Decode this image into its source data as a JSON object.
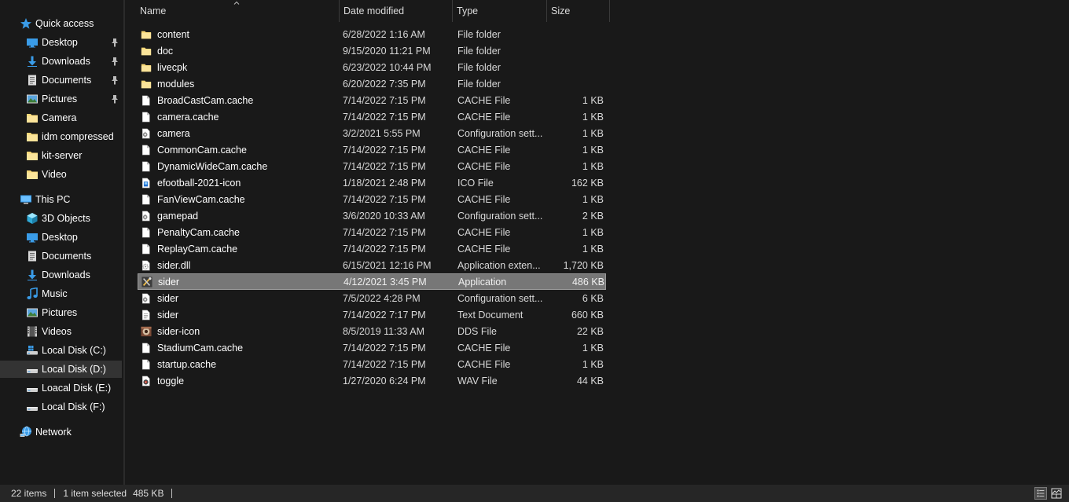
{
  "nav": {
    "quick_access": "Quick access",
    "quick_items": [
      {
        "label": "Desktop",
        "icon": "desktop-icon",
        "pinned": true
      },
      {
        "label": "Downloads",
        "icon": "download-icon",
        "pinned": true
      },
      {
        "label": "Documents",
        "icon": "documents-icon",
        "pinned": true
      },
      {
        "label": "Pictures",
        "icon": "pictures-icon",
        "pinned": true
      },
      {
        "label": "Camera",
        "icon": "folder-icon",
        "pinned": false
      },
      {
        "label": "idm compressed",
        "icon": "folder-icon",
        "pinned": false
      },
      {
        "label": "kit-server",
        "icon": "folder-icon",
        "pinned": false
      },
      {
        "label": "Video",
        "icon": "folder-icon",
        "pinned": false
      }
    ],
    "this_pc": "This PC",
    "pc_items": [
      {
        "label": "3D Objects",
        "icon": "3d-objects-icon"
      },
      {
        "label": "Desktop",
        "icon": "desktop-icon"
      },
      {
        "label": "Documents",
        "icon": "documents-icon"
      },
      {
        "label": "Downloads",
        "icon": "download-icon"
      },
      {
        "label": "Music",
        "icon": "music-icon"
      },
      {
        "label": "Pictures",
        "icon": "pictures-icon"
      },
      {
        "label": "Videos",
        "icon": "videos-icon"
      },
      {
        "label": "Local Disk (C:)",
        "icon": "windows-drive-icon"
      },
      {
        "label": "Local Disk (D:)",
        "icon": "drive-icon",
        "selected": true
      },
      {
        "label": "Loacal Disk (E:)",
        "icon": "drive-icon"
      },
      {
        "label": "Local Disk (F:)",
        "icon": "drive-icon"
      }
    ],
    "network": "Network"
  },
  "columns": {
    "name": "Name",
    "date": "Date modified",
    "type": "Type",
    "size": "Size"
  },
  "files": [
    {
      "name": "content",
      "date": "6/28/2022 1:16 AM",
      "type": "File folder",
      "size": "",
      "icon": "folder-icon"
    },
    {
      "name": "doc",
      "date": "9/15/2020 11:21 PM",
      "type": "File folder",
      "size": "",
      "icon": "folder-icon"
    },
    {
      "name": "livecpk",
      "date": "6/23/2022 10:44 PM",
      "type": "File folder",
      "size": "",
      "icon": "folder-icon"
    },
    {
      "name": "modules",
      "date": "6/20/2022 7:35 PM",
      "type": "File folder",
      "size": "",
      "icon": "folder-icon"
    },
    {
      "name": "BroadCastCam.cache",
      "date": "7/14/2022 7:15 PM",
      "type": "CACHE File",
      "size": "1 KB",
      "icon": "file-icon"
    },
    {
      "name": "camera.cache",
      "date": "7/14/2022 7:15 PM",
      "type": "CACHE File",
      "size": "1 KB",
      "icon": "file-icon"
    },
    {
      "name": "camera",
      "date": "3/2/2021 5:55 PM",
      "type": "Configuration sett...",
      "size": "1 KB",
      "icon": "config-file-icon"
    },
    {
      "name": "CommonCam.cache",
      "date": "7/14/2022 7:15 PM",
      "type": "CACHE File",
      "size": "1 KB",
      "icon": "file-icon"
    },
    {
      "name": "DynamicWideCam.cache",
      "date": "7/14/2022 7:15 PM",
      "type": "CACHE File",
      "size": "1 KB",
      "icon": "file-icon"
    },
    {
      "name": "efootball-2021-icon",
      "date": "1/18/2021 2:48 PM",
      "type": "ICO File",
      "size": "162 KB",
      "icon": "ico-file-icon"
    },
    {
      "name": "FanViewCam.cache",
      "date": "7/14/2022 7:15 PM",
      "type": "CACHE File",
      "size": "1 KB",
      "icon": "file-icon"
    },
    {
      "name": "gamepad",
      "date": "3/6/2020 10:33 AM",
      "type": "Configuration sett...",
      "size": "2 KB",
      "icon": "config-file-icon"
    },
    {
      "name": "PenaltyCam.cache",
      "date": "7/14/2022 7:15 PM",
      "type": "CACHE File",
      "size": "1 KB",
      "icon": "file-icon"
    },
    {
      "name": "ReplayCam.cache",
      "date": "7/14/2022 7:15 PM",
      "type": "CACHE File",
      "size": "1 KB",
      "icon": "file-icon"
    },
    {
      "name": "sider.dll",
      "date": "6/15/2021 12:16 PM",
      "type": "Application exten...",
      "size": "1,720 KB",
      "icon": "dll-file-icon"
    },
    {
      "name": "sider",
      "date": "4/12/2021 3:45 PM",
      "type": "Application",
      "size": "486 KB",
      "icon": "application-icon",
      "selected": true
    },
    {
      "name": "sider",
      "date": "7/5/2022 4:28 PM",
      "type": "Configuration sett...",
      "size": "6 KB",
      "icon": "config-file-icon"
    },
    {
      "name": "sider",
      "date": "7/14/2022 7:17 PM",
      "type": "Text Document",
      "size": "660 KB",
      "icon": "text-file-icon"
    },
    {
      "name": "sider-icon",
      "date": "8/5/2019 11:33 AM",
      "type": "DDS File",
      "size": "22 KB",
      "icon": "dds-file-icon"
    },
    {
      "name": "StadiumCam.cache",
      "date": "7/14/2022 7:15 PM",
      "type": "CACHE File",
      "size": "1 KB",
      "icon": "file-icon"
    },
    {
      "name": "startup.cache",
      "date": "7/14/2022 7:15 PM",
      "type": "CACHE File",
      "size": "1 KB",
      "icon": "file-icon"
    },
    {
      "name": "toggle",
      "date": "1/27/2020 6:24 PM",
      "type": "WAV File",
      "size": "44 KB",
      "icon": "audio-file-icon"
    }
  ],
  "status": {
    "count": "22 items",
    "selection": "1 item selected",
    "selection_size": "485 KB"
  },
  "colors": {
    "background": "#191919",
    "selected_row": "#777777",
    "folder": "#f8d775",
    "accent_blue": "#3a9ce8"
  }
}
